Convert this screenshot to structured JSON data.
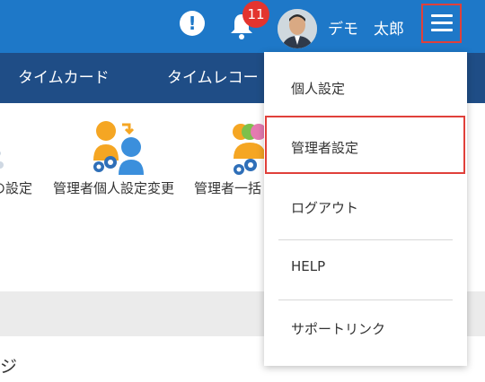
{
  "header": {
    "notification_count": "11",
    "alert_symbol": "!",
    "user_name": "デモ　太郎"
  },
  "nav": {
    "items": [
      "タイムカード",
      "タイムレコー"
    ]
  },
  "tiles": [
    {
      "label": "の設定",
      "icon": "settings-person-icon"
    },
    {
      "label": "管理者個人設定変更",
      "icon": "admin-user-switch-icon"
    },
    {
      "label": "管理者一括",
      "icon": "admin-group-settings-icon"
    }
  ],
  "page": {
    "heading_fragment": "ジ"
  },
  "dropdown": {
    "items": [
      "個人設定",
      "管理者設定",
      "ログアウト",
      "HELP",
      "サポートリンク"
    ],
    "highlighted": "管理者設定"
  },
  "colors": {
    "header": "#1e78c8",
    "nav": "#1f4d86",
    "highlight_border": "#e0403a",
    "badge": "#e3342f"
  }
}
